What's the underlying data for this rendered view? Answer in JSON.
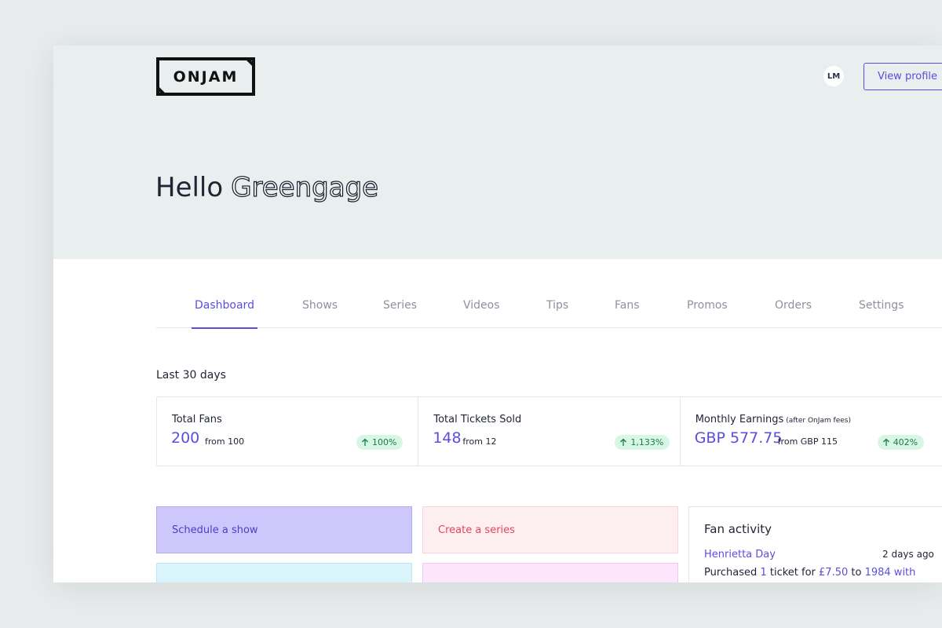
{
  "header": {
    "logo_text": "ONJAM",
    "avatar_initials": "LM",
    "view_profile_label": "View profile",
    "greeting_hello": "Hello",
    "greeting_name": "Greengage"
  },
  "tabs": [
    {
      "label": "Dashboard",
      "active": true
    },
    {
      "label": "Shows"
    },
    {
      "label": "Series"
    },
    {
      "label": "Videos"
    },
    {
      "label": "Tips"
    },
    {
      "label": "Fans"
    },
    {
      "label": "Promos"
    },
    {
      "label": "Orders"
    },
    {
      "label": "Settings"
    }
  ],
  "stats": {
    "period_label": "Last 30 days",
    "items": [
      {
        "title": "Total Fans",
        "note": "",
        "value": "200",
        "from": "from 100",
        "change": "100%"
      },
      {
        "title": "Total Tickets Sold",
        "note": "",
        "value": "148",
        "from": "from 12",
        "change": "1,133%"
      },
      {
        "title": "Monthly Earnings",
        "note": "(after OnJam fees)",
        "value": "GBP 577.75",
        "from": "from GBP 115",
        "change": "402%"
      }
    ]
  },
  "actions": [
    {
      "label": "Schedule a show"
    },
    {
      "label": "Create a series"
    }
  ],
  "fan_activity": {
    "title": "Fan activity",
    "entry": {
      "name": "Henrietta Day",
      "time": "2 days ago",
      "text_1": "Purchased",
      "qty": "1",
      "text_2": "ticket for",
      "price": "£7.50",
      "text_3": "to",
      "show": "1984 with"
    }
  },
  "colors": {
    "accent": "#5b4dde",
    "badge_bg": "#d8f6e6",
    "badge_text": "#1b7a4c",
    "hero_bg": "#e9eeee"
  },
  "icons": {
    "badge": "arrow-up-icon",
    "logo": "onjam-logo"
  }
}
